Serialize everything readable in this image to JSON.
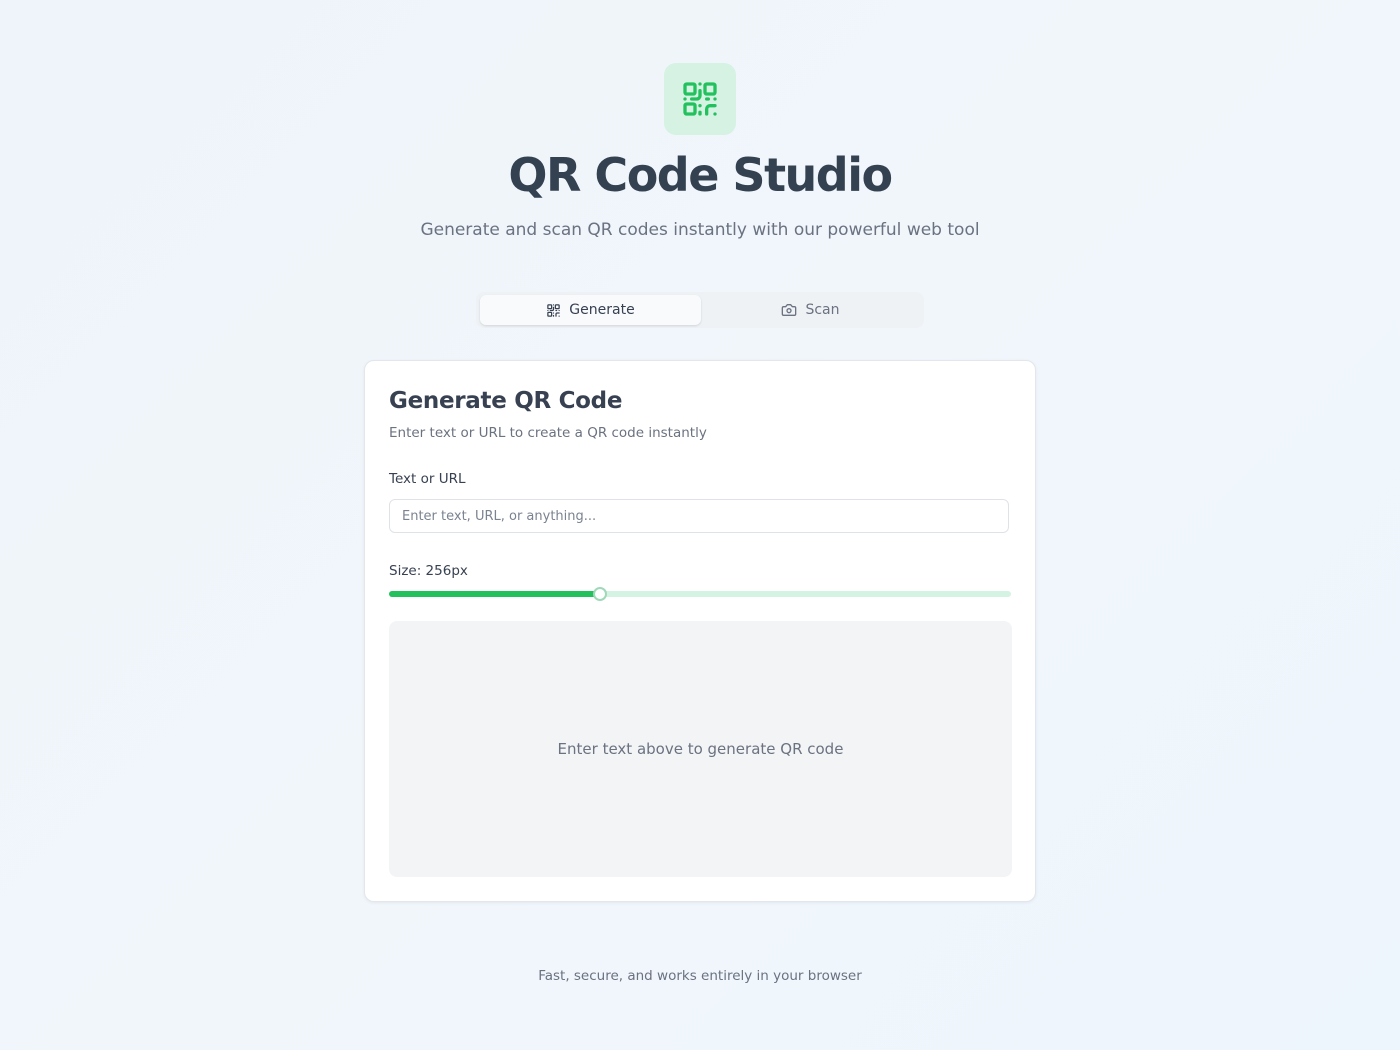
{
  "header": {
    "logo_icon": "qr-code-icon",
    "title": "QR Code Studio",
    "subtitle": "Generate and scan QR codes instantly with our powerful web tool"
  },
  "tabs": [
    {
      "label": "Generate",
      "icon": "qr-code-icon",
      "active": true
    },
    {
      "label": "Scan",
      "icon": "camera-icon",
      "active": false
    }
  ],
  "generate_card": {
    "title": "Generate QR Code",
    "description": "Enter text or URL to create a QR code instantly",
    "input_label": "Text or URL",
    "input_value": "",
    "input_placeholder": "Enter text, URL, or anything...",
    "size_label": "Size: 256px",
    "size_slider_fraction": 0.34,
    "preview_placeholder": "Enter text above to generate QR code"
  },
  "footer": {
    "text": "Fast, secure, and works entirely in your browser"
  },
  "colors": {
    "accent": "#22c15e",
    "accent_light": "#d5f3e2",
    "logo_bg": "#d6f2e3",
    "title": "#344150",
    "muted_text": "#6b7280",
    "preview_bg": "#f3f4f6"
  }
}
